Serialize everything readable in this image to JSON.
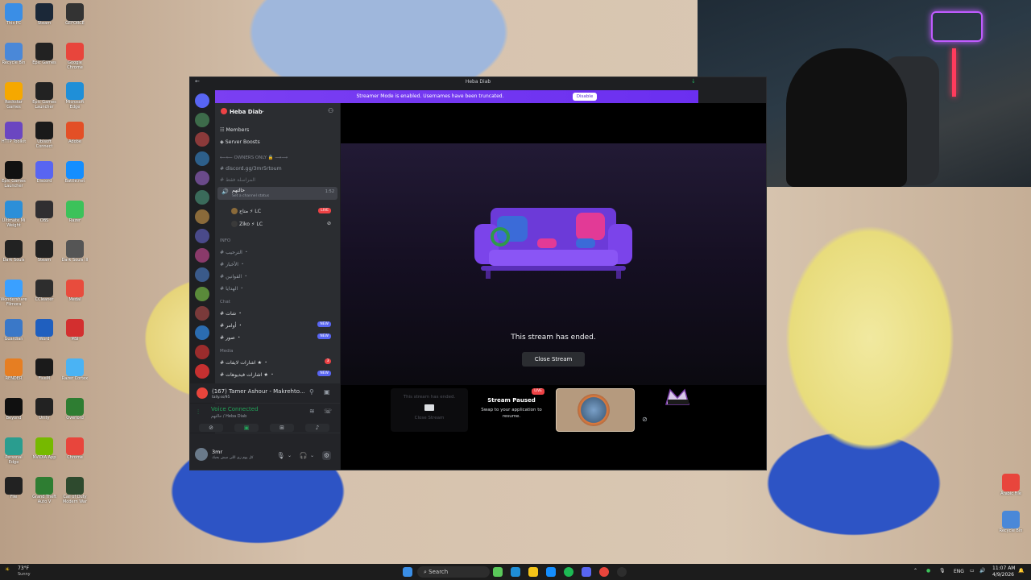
{
  "desktop": {
    "icons_left": [
      {
        "label": "This PC",
        "color": "#3a8ee6"
      },
      {
        "label": "Steam",
        "color": "#1b2838"
      },
      {
        "label": "GEFORCE",
        "color": "#333"
      },
      {
        "label": "Recycle Bin",
        "color": "#4a88d8"
      },
      {
        "label": "Epic Games",
        "color": "#222"
      },
      {
        "label": "Google Chrome",
        "color": "#e8453c"
      },
      {
        "label": "Rockstar Games Launcher",
        "color": "#f6a800"
      },
      {
        "label": "Epic Games Launcher",
        "color": "#222"
      },
      {
        "label": "Microsoft Edge",
        "color": "#1f8fd8"
      },
      {
        "label": "HTTP Toolkit",
        "color": "#6b46c1"
      },
      {
        "label": "Ubisoft Connect",
        "color": "#1a1a1a"
      },
      {
        "label": "Adobe",
        "color": "#e34f26"
      },
      {
        "label": "Epic Games Launcher",
        "color": "#111"
      },
      {
        "label": "Discord",
        "color": "#5865f2"
      },
      {
        "label": "Battle.net",
        "color": "#148eff"
      },
      {
        "label": "Ultimate Mi Weight",
        "color": "#2c8fd8"
      },
      {
        "label": "OBS",
        "color": "#302e31"
      },
      {
        "label": "Razer",
        "color": "#3cc25a"
      },
      {
        "label": "Dark Souls",
        "color": "#222"
      },
      {
        "label": "Steam",
        "color": "#222"
      },
      {
        "label": "Dark Souls III",
        "color": "#555"
      },
      {
        "label": "Wondershare Filmora",
        "color": "#3aa0ff"
      },
      {
        "label": "CCleaner",
        "color": "#2d2d2d"
      },
      {
        "label": "Medal",
        "color": "#e84c3d"
      },
      {
        "label": "Guardian",
        "color": "#3a78c8"
      },
      {
        "label": "Word",
        "color": "#1f5fbf"
      },
      {
        "label": "MSI",
        "color": "#d32f2f"
      },
      {
        "label": "RENDER",
        "color": "#e67e22"
      },
      {
        "label": "FiveM",
        "color": "#1a1a1a"
      },
      {
        "label": "Razer Cortex",
        "color": "#4ab3f4"
      },
      {
        "label": "Beyond",
        "color": "#101010"
      },
      {
        "label": "Unity",
        "color": "#222"
      },
      {
        "label": "Overlord",
        "color": "#2e7d32"
      },
      {
        "label": "Personal Edge",
        "color": "#2a9d8f"
      },
      {
        "label": "NVIDIA App",
        "color": "#76b900"
      },
      {
        "label": "Chrome",
        "color": "#e8453c"
      },
      {
        "label": "File",
        "color": "#222"
      },
      {
        "label": "Grand Theft Auto V",
        "color": "#2e7d32"
      },
      {
        "label": "Call of Duty Modern War",
        "color": "#2e4a2e"
      }
    ],
    "icons_right": [
      {
        "label": "Arabic File",
        "color": "#e8453c"
      },
      {
        "label": "Recycle Bin",
        "color": "#4a88d8"
      }
    ]
  },
  "discord": {
    "window_title": "Heba Diab",
    "banner": {
      "text": "Streamer Mode is enabled. Usernames have been truncated.",
      "button": "Disable"
    },
    "server_name": "Heba Diab",
    "nav": [
      {
        "label": "Members",
        "icon": "members-icon"
      },
      {
        "label": "Server Boosts",
        "icon": "boost-icon"
      }
    ],
    "channels_top": [
      {
        "label": "⟵⟵ OWNERS ONLY 🔒 ⟶⟶"
      },
      {
        "label": "discord.gg/3mr5rtoum"
      },
      {
        "label": "المراسلة فقط"
      }
    ],
    "voice_channel": {
      "label": "حالتهم",
      "status": "Set a channel status",
      "time": "1:52"
    },
    "voice_users": [
      {
        "name": "متاح ⚡ LC",
        "live": "LIVE"
      },
      {
        "name": "Ziko ⚡ LC",
        "live": ""
      }
    ],
    "cat_info": "INFO",
    "info_channels": [
      "الترحيب ・",
      "الأخبار ・",
      "القوانين ・",
      "الهدايا ・"
    ],
    "cat_chat": "Chat",
    "chat_channels": [
      {
        "label": "شات ・",
        "badge": ""
      },
      {
        "label": "أوامر ・",
        "badge": "NEW"
      },
      {
        "label": "صور ・",
        "badge": "NEW"
      }
    ],
    "cat_media": "Media",
    "media_channels": [
      {
        "label": "اشارات لايفات ★ ・",
        "badge": "3"
      },
      {
        "label": "اشارات فيديوهات ★ ・",
        "badge": "NEW"
      }
    ],
    "activity": {
      "text": "(167) Tamer Ashour - Makrehto...",
      "sub": "tally.ss/95"
    },
    "voice": {
      "connected": "Voice Connected",
      "channel": "حالتهم / Heba Diab"
    },
    "user": {
      "name": "3mr",
      "status": "كل يوم زي اللي ميش بحبك"
    },
    "stream": {
      "ended_text": "This stream has ended.",
      "close_label": "Close Stream",
      "tile_ended_text": "This stream has ended.",
      "tile_close_text": "Close Stream",
      "paused_title": "Stream Paused",
      "paused_sub": "Swap to your application to resume.",
      "live_badge": "LIVE"
    }
  },
  "taskbar": {
    "weather_temp": "73°F",
    "weather_desc": "Sunny",
    "search_placeholder": "Search",
    "lang": "ENG",
    "time": "11:07 AM",
    "date": "4/9/2026"
  }
}
